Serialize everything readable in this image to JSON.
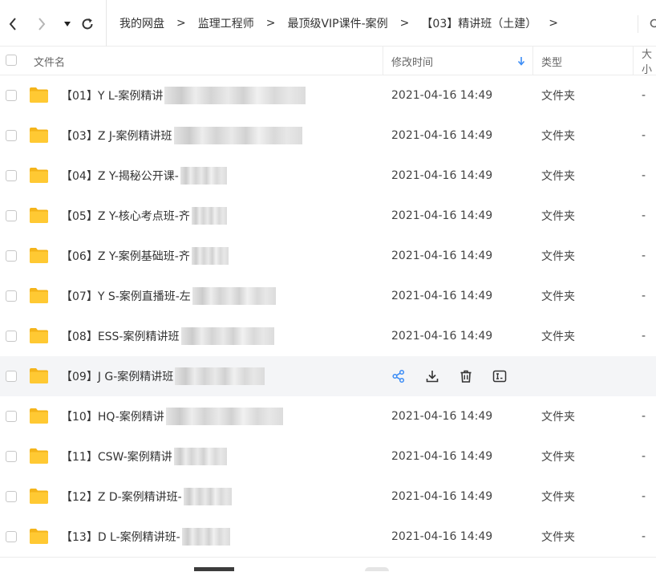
{
  "toolbar": {
    "breadcrumbs": [
      "我的网盘",
      "监理工程师",
      "最顶级VIP课件-案例",
      "【03】精讲班（土建）"
    ],
    "separator": ">"
  },
  "columns": {
    "name": "文件名",
    "mtime": "修改时间",
    "type": "类型",
    "size": "大小"
  },
  "sort": {
    "column": "mtime",
    "direction": "descending"
  },
  "colors": {
    "folder": "#ffc933",
    "action_blue": "#3b8cf5",
    "hover_row": "#f4f5f7"
  },
  "files": [
    {
      "name": "【01】Y  L-案例精讲",
      "mtime": "2021-04-16 14:49",
      "type": "文件夹",
      "size": "-"
    },
    {
      "name": "【03】Z  J-案例精讲班",
      "mtime": "2021-04-16 14:49",
      "type": "文件夹",
      "size": "-"
    },
    {
      "name": "【04】Z  Y-揭秘公开课-",
      "mtime": "2021-04-16 14:49",
      "type": "文件夹",
      "size": "-"
    },
    {
      "name": "【05】Z Y-核心考点班-齐",
      "mtime": "2021-04-16 14:49",
      "type": "文件夹",
      "size": "-"
    },
    {
      "name": "【06】Z Y-案例基础班-齐",
      "mtime": "2021-04-16 14:49",
      "type": "文件夹",
      "size": "-"
    },
    {
      "name": "【07】Y S-案例直播班-左",
      "mtime": "2021-04-16 14:49",
      "type": "文件夹",
      "size": "-"
    },
    {
      "name": "【08】ESS-案例精讲班",
      "mtime": "2021-04-16 14:49",
      "type": "文件夹",
      "size": "-"
    },
    {
      "name": "【09】J G-案例精讲班",
      "mtime": "",
      "type": "",
      "size": ""
    },
    {
      "name": "【10】HQ-案例精讲",
      "mtime": "2021-04-16 14:49",
      "type": "文件夹",
      "size": "-"
    },
    {
      "name": "【11】CSW-案例精讲",
      "mtime": "2021-04-16 14:49",
      "type": "文件夹",
      "size": "-"
    },
    {
      "name": "【12】Z D-案例精讲班-",
      "mtime": "2021-04-16 14:49",
      "type": "文件夹",
      "size": "-"
    },
    {
      "name": "【13】D L-案例精讲班-",
      "mtime": "2021-04-16 14:49",
      "type": "文件夹",
      "size": "-"
    }
  ],
  "hovered_row": 7,
  "row_actions": [
    "share-icon",
    "download-icon",
    "delete-icon",
    "rename-icon"
  ]
}
